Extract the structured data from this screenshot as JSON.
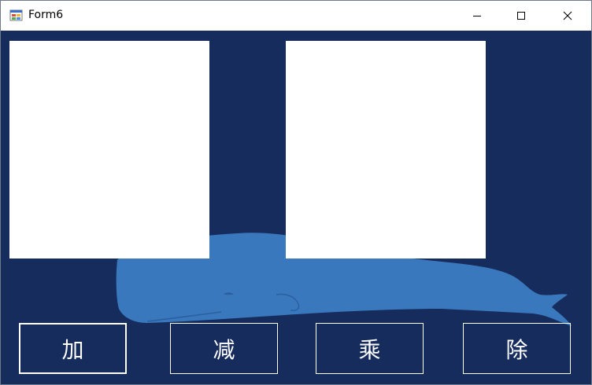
{
  "window": {
    "title": "Form6"
  },
  "titlebar_icons": {
    "app": "form-app-icon",
    "minimize": "minimize-icon",
    "maximize": "maximize-icon",
    "close": "close-icon"
  },
  "panels": {
    "left": "",
    "right": ""
  },
  "buttons": {
    "add": "加",
    "subtract": "减",
    "multiply": "乘",
    "divide": "除"
  },
  "colors": {
    "background": "#162c5c",
    "whale": "#3a78be",
    "panel": "#ffffff",
    "button_border": "#ffffff"
  }
}
